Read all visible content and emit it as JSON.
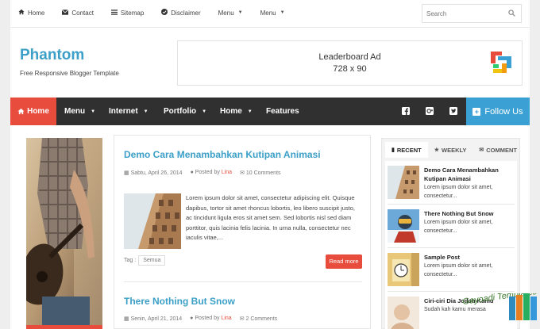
{
  "topbar": {
    "links": [
      {
        "label": "Home",
        "icon": "home-icon",
        "caret": false
      },
      {
        "label": "Contact",
        "icon": "envelope-icon",
        "caret": false
      },
      {
        "label": "Sitemap",
        "icon": "list-icon",
        "caret": false
      },
      {
        "label": "Disclaimer",
        "icon": "check-circle-icon",
        "caret": false
      },
      {
        "label": "Menu",
        "icon": "",
        "caret": true
      },
      {
        "label": "Menu",
        "icon": "",
        "caret": true
      }
    ],
    "search_placeholder": "Search"
  },
  "header": {
    "logo": "Phantom",
    "tagline": "Free Responsive Blogger Template",
    "ad_line1": "Leaderboard Ad",
    "ad_line2": "728 x 90"
  },
  "nav": {
    "items": [
      {
        "label": "Home",
        "active": true,
        "caret": false
      },
      {
        "label": "Menu",
        "active": false,
        "caret": true
      },
      {
        "label": "Internet",
        "active": false,
        "caret": true
      },
      {
        "label": "Portfolio",
        "active": false,
        "caret": true
      },
      {
        "label": "Home",
        "active": false,
        "caret": true
      },
      {
        "label": "Features",
        "active": false,
        "caret": false
      }
    ],
    "social_icons": [
      "facebook-icon",
      "google-plus-icon",
      "twitter-icon"
    ],
    "follow_label": "Follow Us"
  },
  "posts": [
    {
      "title": "Demo Cara Menambahkan Kutipan Animasi",
      "date": "Sabtu, April 26, 2014",
      "posted_by": "Posted by",
      "author": "Lina",
      "comments": "10 Comments",
      "excerpt": "Lorem ipsum dolor sit amet, consectetur adipiscing elit. Quisque dapibus, tortor sit amet rhoncus lobortis, leo libero suscipit justo, ac tincidunt ligula eros sit amet sem. Sed lobortis nisl sed diam porttitor, quis lacinia felis lacinia. In urna nulla, consectetur nec iaculis vitae,...",
      "tag_label": "Tag :",
      "tag": "Semua",
      "read_more": "Read more"
    },
    {
      "title": "There Nothing But Snow",
      "date": "Senin, April 21, 2014",
      "posted_by": "Posted by",
      "author": "Lina",
      "comments": "2 Comments"
    }
  ],
  "sidebar": {
    "tabs": [
      {
        "label": "RECENT",
        "icon": "bookmark-icon",
        "active": true
      },
      {
        "label": "WEEKLY",
        "icon": "star-icon",
        "active": false
      },
      {
        "label": "COMMENT",
        "icon": "comment-icon",
        "active": false
      }
    ],
    "items": [
      {
        "title": "Demo Cara Menambahkan Kutipan Animasi",
        "excerpt": "Lorem ipsum dolor sit amet, consectetur..."
      },
      {
        "title": "There Nothing But Snow",
        "excerpt": "Lorem ipsum dolor sit amet, consectetur..."
      },
      {
        "title": "Sample Post",
        "excerpt": "Lorem ipsum dolor sit amet, consectetur..."
      },
      {
        "title": "Ciri-ciri Dia Jodoh Kamu",
        "excerpt": "Sudah kah kamu merasa"
      }
    ]
  },
  "watermark": "Gayoadi Templates",
  "colors": {
    "accent": "#3b9fc7",
    "red": "#e74c3c",
    "nav": "#303030",
    "follow": "#3ba0d4"
  }
}
